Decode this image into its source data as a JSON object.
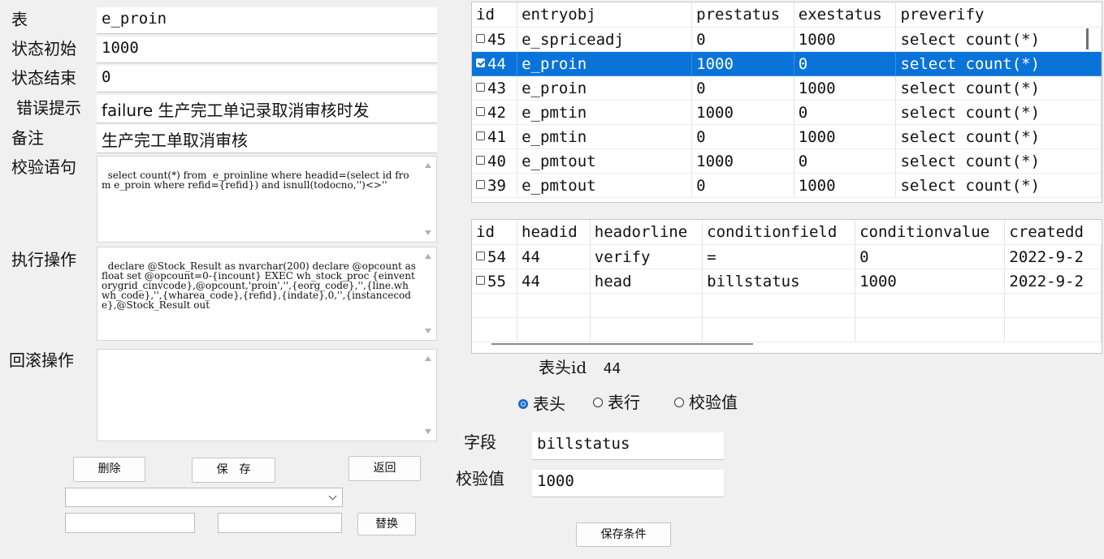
{
  "form": {
    "table_label": "表",
    "table_value": "e_proin",
    "init_status_label": "状态初始",
    "init_status_value": "1000",
    "end_status_label": "状态结束",
    "end_status_value": "0",
    "error_tip_label": "错误提示",
    "error_tip_value": "failure 生产完工单记录取消审核时发",
    "remark_label": "备注",
    "remark_value": "生产完工单取消审核",
    "verify_sql_label": "校验语句",
    "verify_sql_value": "select count(*) from  e_proinline where headid=(select id from e_proin where refid={refid}) and isnull(todocno,'')<>''",
    "exec_op_label": "执行操作",
    "exec_op_value": "declare @Stock_Result as nvarchar(200) declare @opcount as float set @opcount=0-{incount} EXEC wh_stock_proc {einventorygrid_cinvcode},@opcount,'proin','',{eorg_code},'',{line.whwh_code},'',{wharea_code},{refid},{indate},0,'',{instancecode},@Stock_Result out",
    "rollback_label": "回滚操作",
    "rollback_value": ""
  },
  "buttons": {
    "delete": "删除",
    "save": "保　存",
    "back": "返回",
    "replace": "替换",
    "save_condition": "保存条件"
  },
  "replace_bar": {
    "select_value": "",
    "find_value": "",
    "replace_value": ""
  },
  "entry_grid": {
    "columns": [
      "id",
      "entryobj",
      "prestatus",
      "exestatus",
      "preverify"
    ],
    "rows": [
      {
        "id": "45",
        "entryobj": "e_spriceadj",
        "prestatus": "0",
        "exestatus": "1000",
        "preverify": "select count(*)",
        "checked": false,
        "selected": false
      },
      {
        "id": "44",
        "entryobj": "e_proin",
        "prestatus": "1000",
        "exestatus": "0",
        "preverify": "select count(*)",
        "checked": true,
        "selected": true
      },
      {
        "id": "43",
        "entryobj": "e_proin",
        "prestatus": "0",
        "exestatus": "1000",
        "preverify": "select count(*)",
        "checked": false,
        "selected": false
      },
      {
        "id": "42",
        "entryobj": "e_pmtin",
        "prestatus": "1000",
        "exestatus": "0",
        "preverify": "select count(*)",
        "checked": false,
        "selected": false
      },
      {
        "id": "41",
        "entryobj": "e_pmtin",
        "prestatus": "0",
        "exestatus": "1000",
        "preverify": "select count(*)",
        "checked": false,
        "selected": false
      },
      {
        "id": "40",
        "entryobj": "e_pmtout",
        "prestatus": "1000",
        "exestatus": "0",
        "preverify": "select count(*)",
        "checked": false,
        "selected": false
      },
      {
        "id": "39",
        "entryobj": "e_pmtout",
        "prestatus": "0",
        "exestatus": "1000",
        "preverify": "select count(*)",
        "checked": false,
        "selected": false
      }
    ]
  },
  "condition_grid": {
    "columns": [
      "id",
      "headid",
      "headorline",
      "conditionfield",
      "conditionvalue",
      "createdd"
    ],
    "rows": [
      {
        "id": "54",
        "headid": "44",
        "headorline": "verify",
        "conditionfield": "=",
        "conditionvalue": "0",
        "createdd": "2022-9-2"
      },
      {
        "id": "55",
        "headid": "44",
        "headorline": "head",
        "conditionfield": "billstatus",
        "conditionvalue": "1000",
        "createdd": "2022-9-2"
      }
    ]
  },
  "condition_form": {
    "head_id_label": "表头id",
    "head_id_value": "44",
    "radio_options": [
      "表头",
      "表行",
      "校验值"
    ],
    "radio_selected": "表头",
    "field_label": "字段",
    "field_value": "billstatus",
    "check_value_label": "校验值",
    "check_value_value": "1000"
  }
}
